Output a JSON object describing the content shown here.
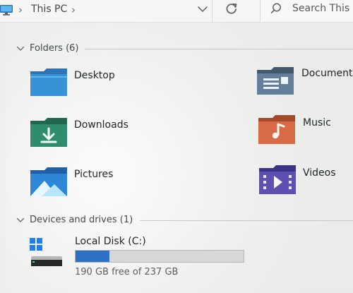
{
  "header": {
    "location": "This PC",
    "search_placeholder": "Search This PC"
  },
  "sections": {
    "folders": {
      "label": "Folders (6)",
      "items": [
        {
          "label": "Desktop"
        },
        {
          "label": "Documents"
        },
        {
          "label": "Downloads"
        },
        {
          "label": "Music"
        },
        {
          "label": "Pictures"
        },
        {
          "label": "Videos"
        }
      ]
    },
    "devices": {
      "label": "Devices and drives (1)",
      "drive": {
        "label": "Local Disk (C:)",
        "free_text": "190 GB free of 237 GB",
        "used_fraction": 0.2
      }
    }
  },
  "colors": {
    "accent": "#2f72c5",
    "desktop": "#2e88d1",
    "documents": "#5c7792",
    "downloads": "#2d8a68",
    "music": "#d06a45",
    "pictures": "#2c7fd0",
    "videos": "#5b4ea9"
  },
  "icons": {
    "pc": "pc-icon",
    "breadcrumb_chevron": "chevron-right-icon",
    "dropdown": "chevron-down-icon",
    "refresh": "refresh-icon",
    "search": "search-icon",
    "section_expand": "chevron-down-icon",
    "desktop": "desktop-folder-icon",
    "documents": "documents-folder-icon",
    "downloads": "downloads-folder-icon",
    "music": "music-folder-icon",
    "pictures": "pictures-folder-icon",
    "videos": "videos-folder-icon",
    "drive": "local-disk-icon"
  }
}
